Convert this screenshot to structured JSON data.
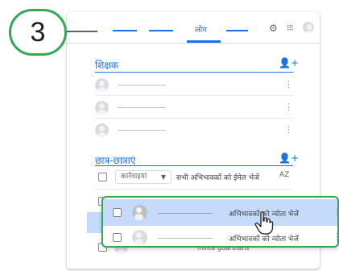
{
  "step": {
    "number": "3"
  },
  "header": {
    "active_tab": "लोग",
    "icons": [
      "gear-icon",
      "apps-grid-icon",
      "account-avatar-icon"
    ]
  },
  "teachers": {
    "title": "शिक्षक",
    "add_icon": "add-person-icon",
    "rows": 3
  },
  "students": {
    "title": "छात्र-छात्राएं",
    "add_icon": "add-person-icon",
    "actions_placeholder": "कार्रवाइयां",
    "email_all_guardians": "सभी अभिभावकों को ईमेल भेजें",
    "sort_label": "AZ",
    "peek_text": "invite guardians"
  },
  "popout": {
    "rows": [
      {
        "label": "अभिभावकों को न्योता भेजें",
        "highlighted": true
      },
      {
        "label": "अभिभावकों को न्योता भेजें",
        "highlighted": false
      }
    ]
  },
  "colors": {
    "accent": "#1a73e8",
    "callout_green": "#34a853",
    "highlight_row": "#c6dafc"
  }
}
